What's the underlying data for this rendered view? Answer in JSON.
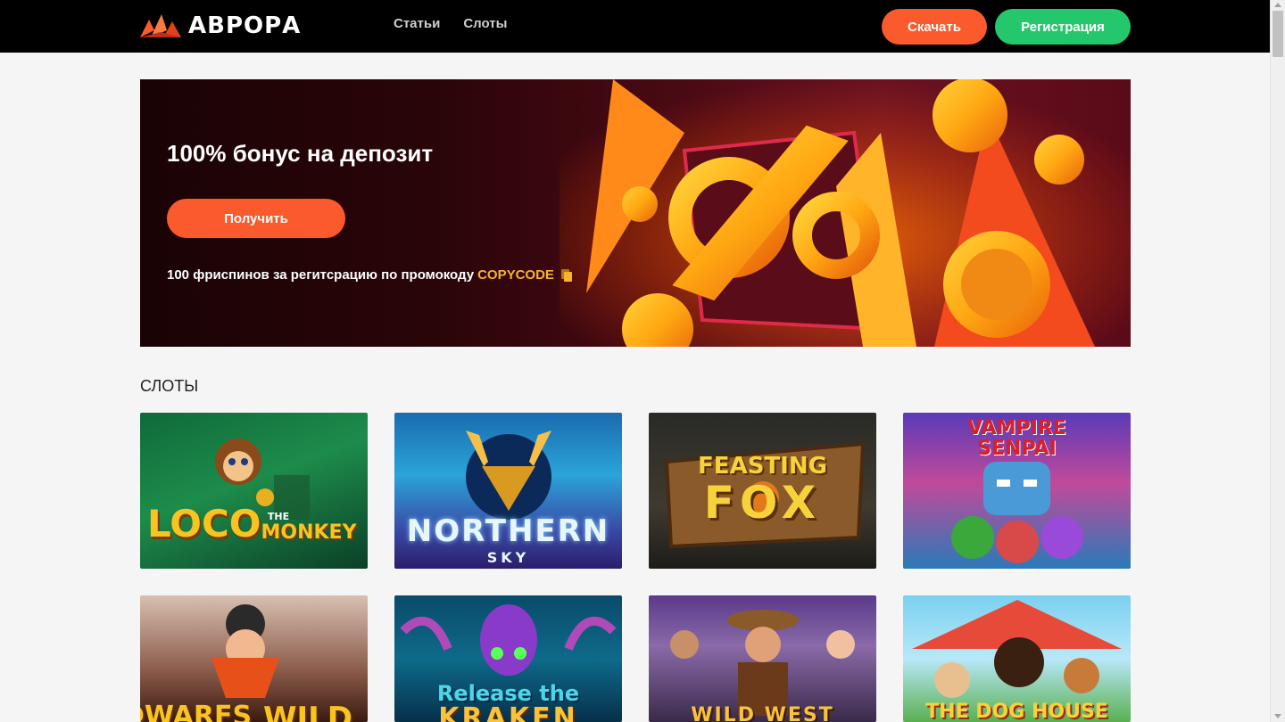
{
  "header": {
    "logo_text": "АВРОРА",
    "nav": [
      "Статьи",
      "Слоты"
    ],
    "download_label": "Скачать",
    "register_label": "Регистрация"
  },
  "banner": {
    "title": "100% бонус на депозит",
    "button_label": "Получить",
    "promo_text": "100 фриспинов за регитсрацию по промокоду",
    "promo_code": "COPYCODE"
  },
  "slots": {
    "section_title": "СЛОТЫ",
    "items": [
      {
        "line1": "LOCO",
        "line2": "THE",
        "line3": "MONKEY"
      },
      {
        "line1": "NORTHERN",
        "line2": "SKY"
      },
      {
        "line1": "FEASTING",
        "line2": "FOX"
      },
      {
        "line1": "VAMPIRE",
        "line2": "SENPAI"
      },
      {
        "line1": "DWARFS",
        "line2": "WILD"
      },
      {
        "line1": "Release the",
        "line2": "KRAKEN"
      },
      {
        "line1": "WILD WEST"
      },
      {
        "line1": "THE DOG HOUSE"
      }
    ]
  },
  "colors": {
    "accent_orange": "#fb5a2c",
    "accent_green": "#25c76c",
    "promo_yellow": "#f7b42c"
  }
}
